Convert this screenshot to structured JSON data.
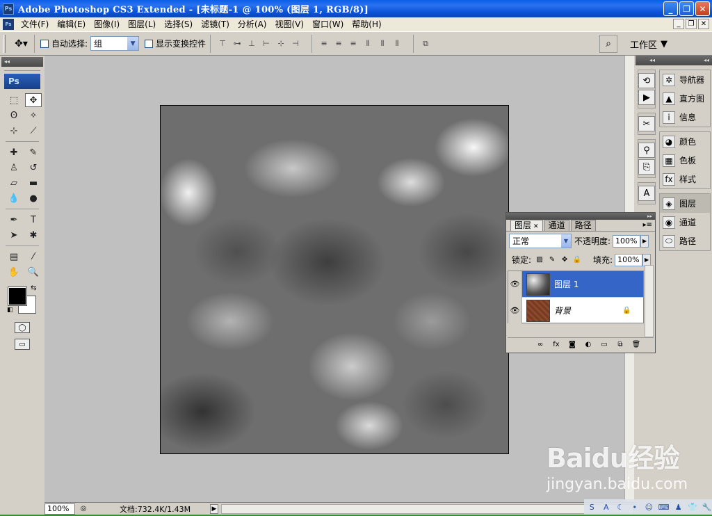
{
  "titlebar": {
    "title": "Adobe Photoshop CS3 Extended - [未标题-1 @ 100% (图层 1, RGB/8)]",
    "logo": "Ps",
    "buttons": [
      "minimize-icon",
      "restore-icon",
      "close-icon"
    ]
  },
  "menu": {
    "items": [
      "文件(F)",
      "编辑(E)",
      "图像(I)",
      "图层(L)",
      "选择(S)",
      "滤镜(T)",
      "分析(A)",
      "视图(V)",
      "窗口(W)",
      "帮助(H)"
    ]
  },
  "options": {
    "auto_select_label": "自动选择:",
    "auto_select_value": "组",
    "show_transform_label": "显示变换控件",
    "workspace_label": "工作区"
  },
  "tools": {
    "badge": "Ps",
    "items": [
      "marquee-icon",
      "move-icon",
      "lasso-icon",
      "magic-wand-icon",
      "crop-icon",
      "slice-icon",
      "healing-icon",
      "brush-icon",
      "stamp-icon",
      "history-brush-icon",
      "eraser-icon",
      "gradient-icon",
      "blur-icon",
      "dodge-icon",
      "pen-icon",
      "type-icon",
      "path-select-icon",
      "shape-icon",
      "notes-icon",
      "eyedropper-icon",
      "hand-icon",
      "zoom-icon"
    ],
    "foreground_color": "#000000",
    "background_color": "#ffffff"
  },
  "statusbar": {
    "zoom": "100%",
    "doc_info": "文档:732.4K/1.43M"
  },
  "dock": {
    "items": [
      {
        "label": "导航器",
        "icon": "navigator-icon"
      },
      {
        "label": "直方图",
        "icon": "histogram-icon"
      },
      {
        "label": "信息",
        "icon": "info-icon"
      },
      {
        "label": "颜色",
        "icon": "color-icon"
      },
      {
        "label": "色板",
        "icon": "swatches-icon"
      },
      {
        "label": "样式",
        "icon": "styles-icon"
      },
      {
        "label": "图层",
        "icon": "layers-icon"
      },
      {
        "label": "通道",
        "icon": "channels-icon"
      },
      {
        "label": "路径",
        "icon": "paths-icon"
      }
    ]
  },
  "layers_panel": {
    "tabs": [
      "图层",
      "通道",
      "路径"
    ],
    "blend_mode": "正常",
    "opacity_label": "不透明度:",
    "opacity_value": "100%",
    "lock_label": "锁定:",
    "fill_label": "填充:",
    "fill_value": "100%",
    "layers": [
      {
        "name": "图层 1",
        "selected": true
      },
      {
        "name": "背景",
        "locked": true
      }
    ]
  },
  "watermark": {
    "brand": "Baidu经验",
    "url": "jingyan.baidu.com"
  }
}
